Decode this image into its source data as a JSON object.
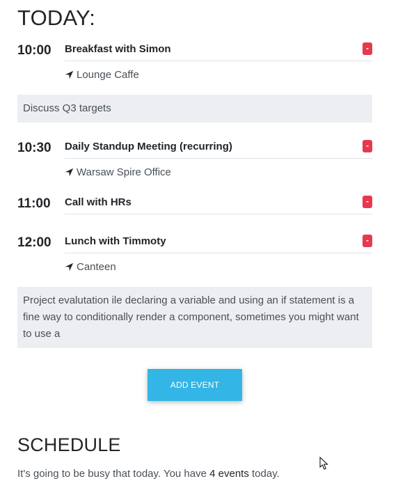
{
  "today": {
    "heading": "TODAY:",
    "events": [
      {
        "time": "10:00",
        "title": "Breakfast with Simon",
        "location": "Lounge Caffe",
        "note": "Discuss Q3 targets",
        "remove_label": "-"
      },
      {
        "time": "10:30",
        "title": "Daily Standup Meeting (recurring)",
        "location": "Warsaw Spire Office",
        "remove_label": "-"
      },
      {
        "time": "11:00",
        "title": "Call with HRs",
        "remove_label": "-"
      },
      {
        "time": "12:00",
        "title": "Lunch with Timmoty",
        "location": "Canteen",
        "note": "Project evalutation ile declaring a variable and using an if statement is a fine way to conditionally render a component, sometimes you might want to use a",
        "remove_label": "-"
      }
    ],
    "add_button_label": "ADD EVENT"
  },
  "schedule": {
    "heading": "SCHEDULE",
    "summary_prefix": "It's going to be busy that today. You have ",
    "summary_count": "4 events",
    "summary_suffix": " today."
  },
  "colors": {
    "remove": "#e8384f",
    "accent": "#33b5e5",
    "note_bg": "#eceef1"
  },
  "icons": {
    "location": "location-arrow-icon",
    "remove": "minus-icon",
    "cursor": "mouse-pointer-icon"
  }
}
